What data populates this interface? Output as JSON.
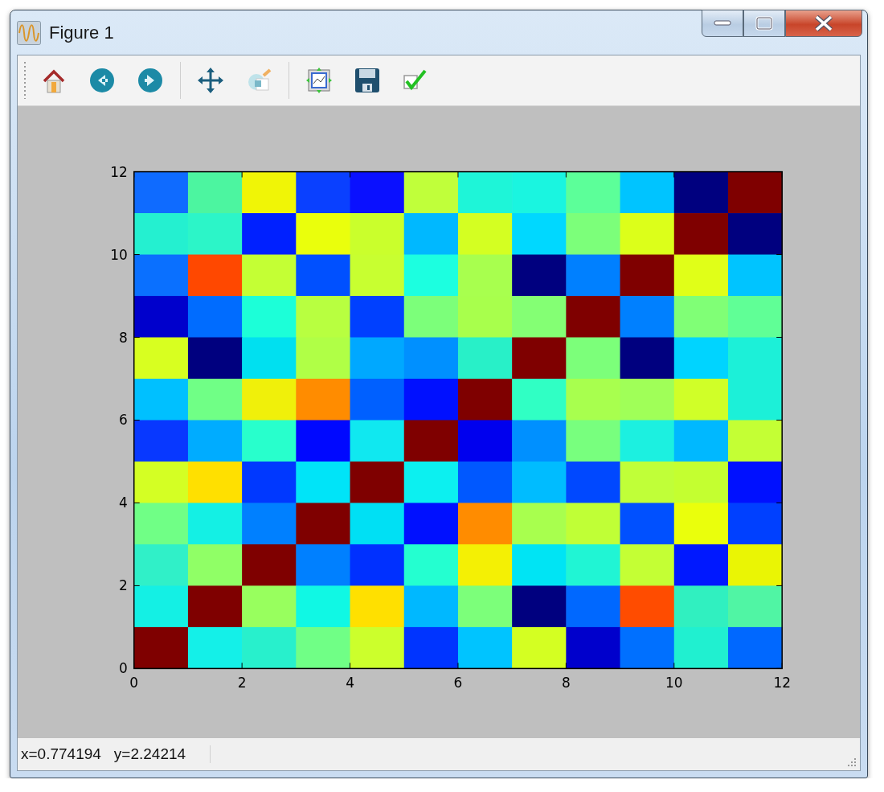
{
  "window": {
    "title": "Figure 1"
  },
  "plot": {
    "xticks": [
      "0",
      "2",
      "4",
      "6",
      "8",
      "10",
      "12"
    ],
    "yticks": [
      "12",
      "10",
      "8",
      "6",
      "4",
      "2",
      "0"
    ]
  },
  "status_bar": {
    "coordinates": [
      "x=0.774194",
      "y=2.24214"
    ]
  }
}
